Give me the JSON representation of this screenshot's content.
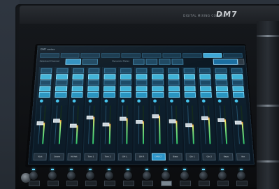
{
  "photo": {
    "brand_model": "DM7",
    "brand_small_text": "DIGITAL MIXING CONSOLE"
  },
  "screen": {
    "title_text": "DM7 series",
    "version_text": "",
    "control_labels": [
      "Selected Channel",
      "Dynamic Meter"
    ],
    "channel_names": [
      "Kick",
      "Snare",
      "Hi Hat",
      "Tom 1",
      "Tom 2",
      "OH L",
      "OH R",
      "DIRECT",
      "Bass",
      "Gtr 1",
      "Gtr 2",
      "Keys",
      "Vox"
    ],
    "selected_channel_index": 7,
    "meter_levels": [
      0.55,
      0.62,
      0.48,
      0.7,
      0.52,
      0.66,
      0.58,
      0.74,
      0.6,
      0.5,
      0.68,
      0.63,
      0.57
    ]
  },
  "colors": {
    "screen_accent": "#3fb3d8",
    "screen_background": "#0b1a26",
    "led_blue": "#5fd7ff",
    "console_body": "#101215"
  }
}
